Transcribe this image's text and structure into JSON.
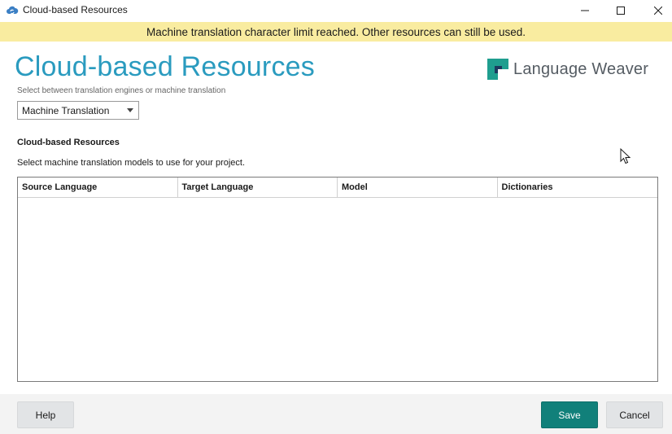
{
  "window": {
    "title": "Cloud-based Resources",
    "icon": "cloud-sync-icon"
  },
  "banner": {
    "message": "Machine translation character limit reached. Other resources can still be used."
  },
  "header": {
    "title": "Cloud-based Resources",
    "logo_text": "Language Weaver",
    "subtitle": "Select between translation engines or machine translation"
  },
  "engine_select": {
    "value": "Machine Translation"
  },
  "section": {
    "heading": "Cloud-based Resources",
    "description": "Select machine translation models to use for your project."
  },
  "grid": {
    "columns": [
      "Source Language",
      "Target Language",
      "Model",
      "Dictionaries"
    ],
    "rows": []
  },
  "footer": {
    "help_label": "Help",
    "save_label": "Save",
    "cancel_label": "Cancel"
  },
  "colors": {
    "accent": "#2a9bbf",
    "primary_button": "#11807a",
    "banner": "#f9eca0"
  }
}
